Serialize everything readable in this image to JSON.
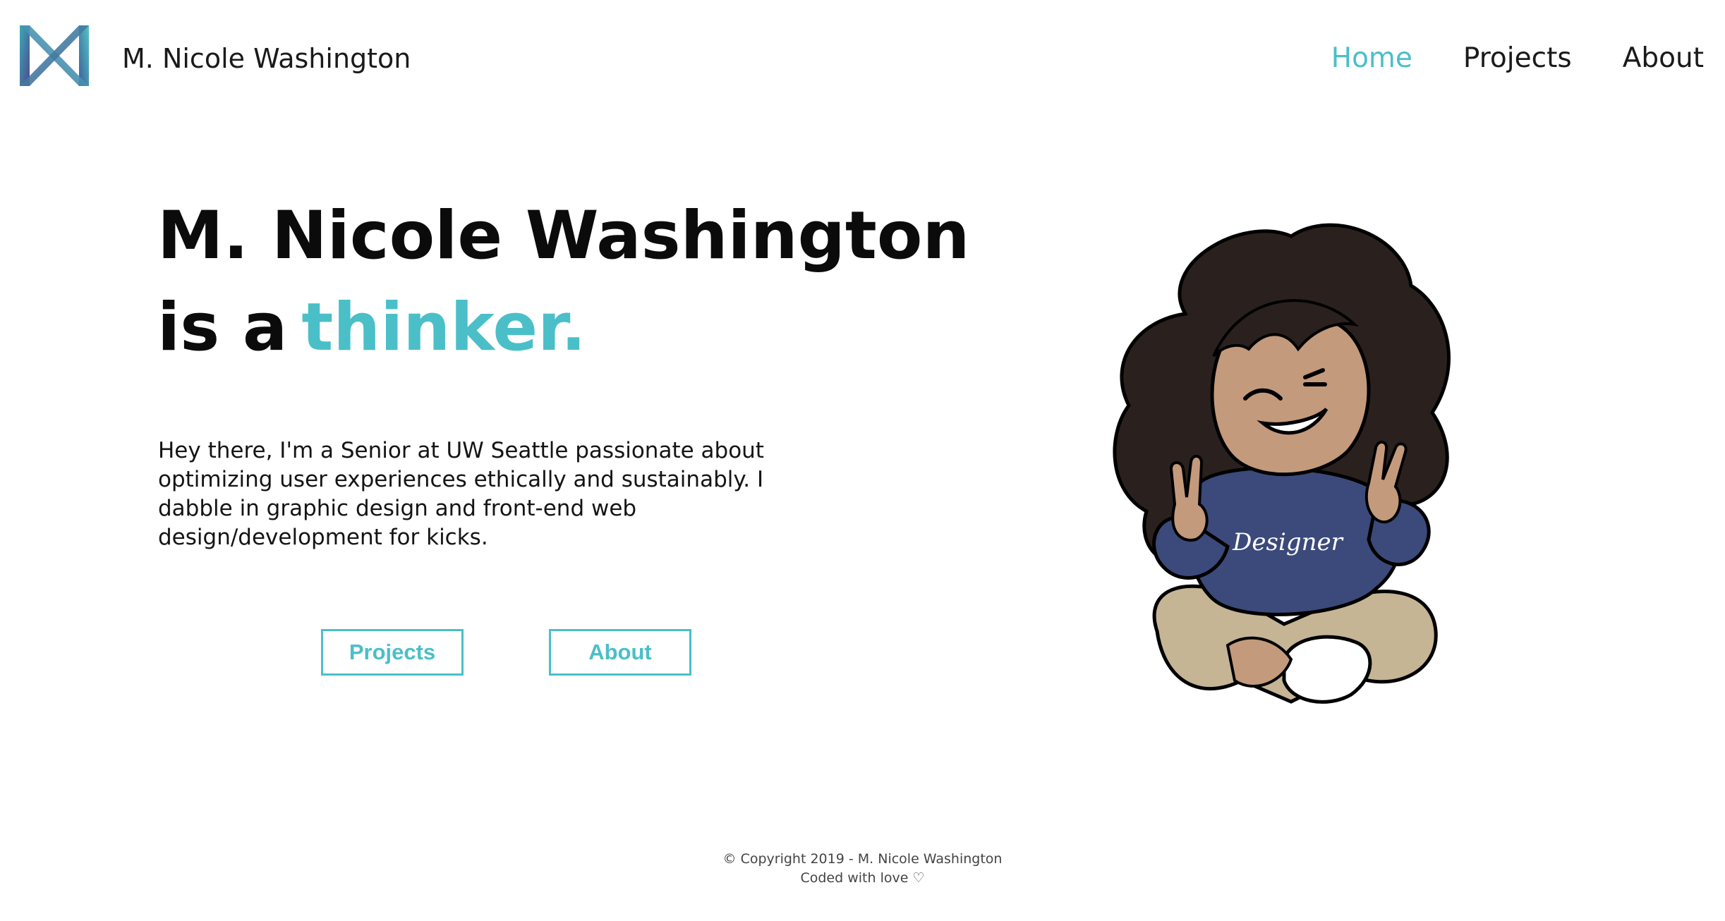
{
  "header": {
    "site_name": "M. Nicole Washington",
    "logo_icon": "mnw-bowtie-logo"
  },
  "nav": {
    "items": [
      {
        "label": "Home",
        "active": true
      },
      {
        "label": "Projects",
        "active": false
      },
      {
        "label": "About",
        "active": false
      }
    ]
  },
  "hero": {
    "headline_line1": "M. Nicole Washington",
    "headline_prefix": "is a",
    "headline_accent": "thinker.",
    "intro": "Hey there, I'm a Senior at UW Seattle passionate about optimizing user experiences ethically and sustainably. I dabble in graphic design and front-end web design/development for kicks.",
    "buttons": {
      "projects": "Projects",
      "about": "About"
    },
    "illustration_hoodie_text": "Designer"
  },
  "footer": {
    "copyright": "© Copyright 2019 - M. Nicole Washington",
    "tagline": "Coded with love ♡"
  },
  "colors": {
    "accent": "#4bbfc8",
    "text": "#111111",
    "background": "#ffffff"
  }
}
